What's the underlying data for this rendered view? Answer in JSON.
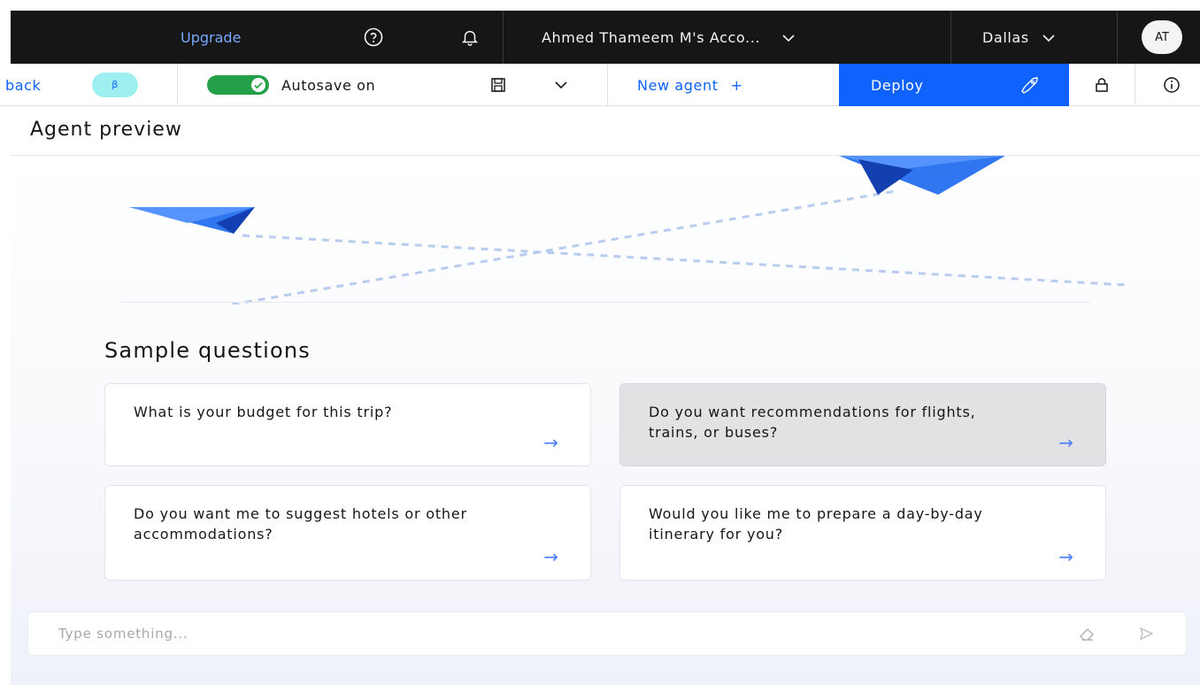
{
  "topbar": {
    "upgrade_label": "Upgrade",
    "account_label": "Ahmed Thameem M's Acco...",
    "region_label": "Dallas",
    "avatar_initials": "AT"
  },
  "toolbar": {
    "back_label": "back",
    "beta_label": "β",
    "autosave_label": "Autosave on",
    "new_agent_label": "New agent",
    "new_agent_plus": "+",
    "deploy_label": "Deploy"
  },
  "preview": {
    "title": "Agent preview",
    "sample_title": "Sample questions",
    "questions": [
      {
        "text": "What is your budget for this trip?"
      },
      {
        "text": "Do you want recommendations for flights, trains, or buses?"
      },
      {
        "text": "Do you want me to suggest hotels or other accommodations?"
      },
      {
        "text": "Would you like me to prepare a day-by-day itinerary for you?"
      }
    ],
    "arrow_glyph": "→",
    "chat_placeholder": "Type something..."
  },
  "icons": {
    "help": "help-icon",
    "notification": "bell-icon",
    "chevron": "chevron-down-icon",
    "save": "save-icon",
    "deploy": "rocket-icon",
    "lock": "lock-icon",
    "info": "info-icon",
    "clear": "eraser-icon",
    "send": "send-icon"
  },
  "colors": {
    "brand_blue": "#0f62fe",
    "topbar_bg": "#161616",
    "toggle_green": "#24a148",
    "link_blue": "#78a9ff",
    "highlight_card": "#e2e2e4"
  }
}
